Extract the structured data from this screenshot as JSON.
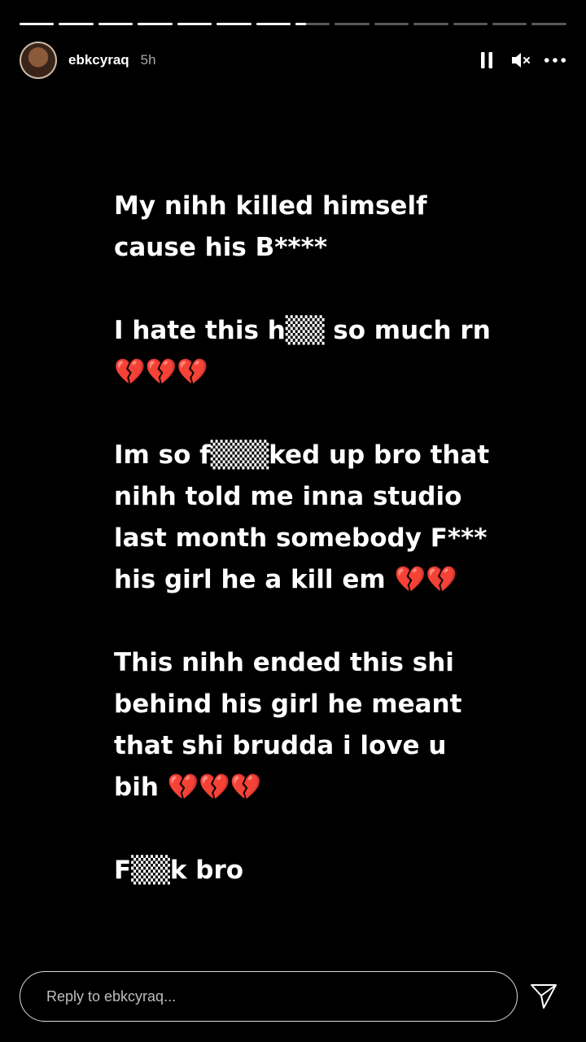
{
  "story": {
    "segment_count": 14,
    "active_segment_index": 7,
    "active_segment_progress": 0.3
  },
  "header": {
    "username": "ebkcyraq",
    "time_ago": "5h",
    "avatar_icon": "profile-photo"
  },
  "controls": {
    "pause_icon": "pause-icon",
    "mute_icon": "mute-icon",
    "more_icon": "more-options-icon"
  },
  "content": {
    "paragraphs": [
      "My nihh killed himself cause his B****",
      "I hate this h▒▒ so much rn💔💔💔",
      "Im so f▒▒▒ked up bro that nihh told me inna studio last month somebody F*** his girl he a kill em 💔💔",
      "This nihh ended this shi behind his girl he meant that shi brudda i love u bih 💔💔💔",
      "F▒▒k bro"
    ]
  },
  "footer": {
    "reply_placeholder": "Reply to ebkcyraq...",
    "reply_value": "",
    "send_icon": "send-icon"
  },
  "colors": {
    "background": "#000000",
    "text": "#ffffff",
    "muted": "#a8a8a8"
  }
}
